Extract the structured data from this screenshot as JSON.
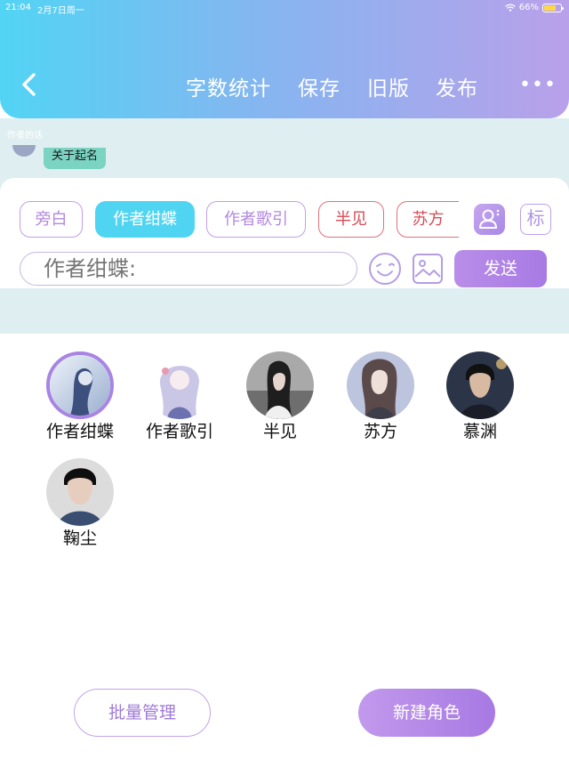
{
  "status_bar": {
    "time": "21:04",
    "date": "2月7日周一",
    "battery": "66%",
    "battery_level": 0.66
  },
  "header": {
    "nav": {
      "word_count": "字数统计",
      "save": "保存",
      "old_version": "旧版",
      "publish": "发布"
    },
    "more": "•••"
  },
  "conversation": {
    "authors_note": "作者的话",
    "name_chip": "关于起名"
  },
  "role_chips": [
    {
      "label": "旁白"
    },
    {
      "label": "作者绀蝶"
    },
    {
      "label": "作者歌引"
    },
    {
      "label": "半见"
    },
    {
      "label": "苏方"
    }
  ],
  "toolbar": {
    "mark": "标"
  },
  "input": {
    "placeholder": "作者绀蝶:",
    "send": "发送"
  },
  "roles": [
    {
      "name": "作者绀蝶"
    },
    {
      "name": "作者歌引"
    },
    {
      "name": "半见"
    },
    {
      "name": "苏方"
    },
    {
      "name": "慕渊"
    },
    {
      "name": "鞠尘"
    }
  ],
  "actions": {
    "batch_manage": "批量管理",
    "new_role": "新建角色"
  },
  "colors": {
    "accent_cyan": "#4fd4f2",
    "accent_purple": "#a77ae4",
    "chip_red": "#d94a55"
  }
}
